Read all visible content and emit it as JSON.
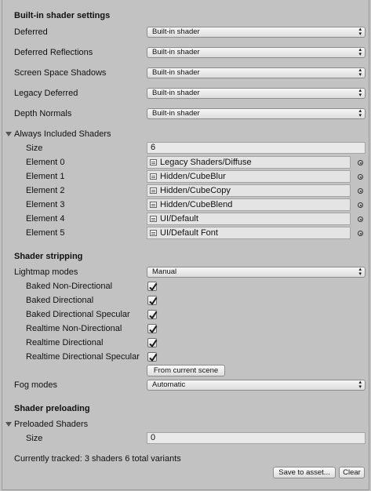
{
  "builtin": {
    "title": "Built-in shader settings",
    "rows": [
      {
        "label": "Deferred",
        "value": "Built-in shader"
      },
      {
        "label": "Deferred Reflections",
        "value": "Built-in shader"
      },
      {
        "label": "Screen Space Shadows",
        "value": "Built-in shader"
      },
      {
        "label": "Legacy Deferred",
        "value": "Built-in shader"
      },
      {
        "label": "Depth Normals",
        "value": "Built-in shader"
      }
    ]
  },
  "always_included": {
    "title": "Always Included Shaders",
    "size_label": "Size",
    "size_value": "6",
    "elements": [
      {
        "label": "Element 0",
        "value": "Legacy Shaders/Diffuse"
      },
      {
        "label": "Element 1",
        "value": "Hidden/CubeBlur"
      },
      {
        "label": "Element 2",
        "value": "Hidden/CubeCopy"
      },
      {
        "label": "Element 3",
        "value": "Hidden/CubeBlend"
      },
      {
        "label": "Element 4",
        "value": "UI/Default"
      },
      {
        "label": "Element 5",
        "value": "UI/Default Font"
      }
    ]
  },
  "stripping": {
    "title": "Shader stripping",
    "lightmap_label": "Lightmap modes",
    "lightmap_value": "Manual",
    "checks": [
      {
        "label": "Baked Non-Directional",
        "checked": true
      },
      {
        "label": "Baked Directional",
        "checked": true
      },
      {
        "label": "Baked Directional Specular",
        "checked": true
      },
      {
        "label": "Realtime Non-Directional",
        "checked": true
      },
      {
        "label": "Realtime Directional",
        "checked": true
      },
      {
        "label": "Realtime Directional Specular",
        "checked": true
      }
    ],
    "from_scene_button": "From current scene",
    "fog_label": "Fog modes",
    "fog_value": "Automatic"
  },
  "preloading": {
    "title": "Shader preloading",
    "preloaded_title": "Preloaded Shaders",
    "size_label": "Size",
    "size_value": "0",
    "tracked_text": "Currently tracked: 3 shaders 6 total variants",
    "save_button": "Save to asset...",
    "clear_button": "Clear"
  }
}
